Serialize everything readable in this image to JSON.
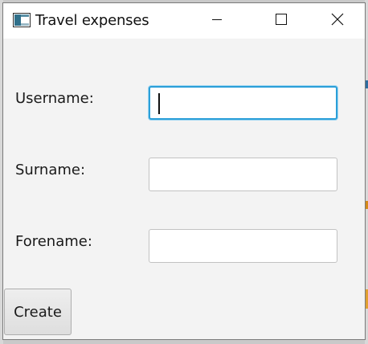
{
  "window": {
    "title": "Travel expenses",
    "icons": {
      "app": "app-window-icon",
      "minimize": "minimize-icon",
      "maximize": "maximize-icon",
      "close": "close-icon"
    }
  },
  "form": {
    "username_label": "Username:",
    "username_value": "",
    "surname_label": "Surname:",
    "surname_value": "",
    "forename_label": "Forename:",
    "forename_value": "",
    "create_label": "Create"
  },
  "colors": {
    "focus_ring": "#2b9fd8",
    "window_bg": "#f3f3f3",
    "titlebar_bg": "#ffffff"
  }
}
